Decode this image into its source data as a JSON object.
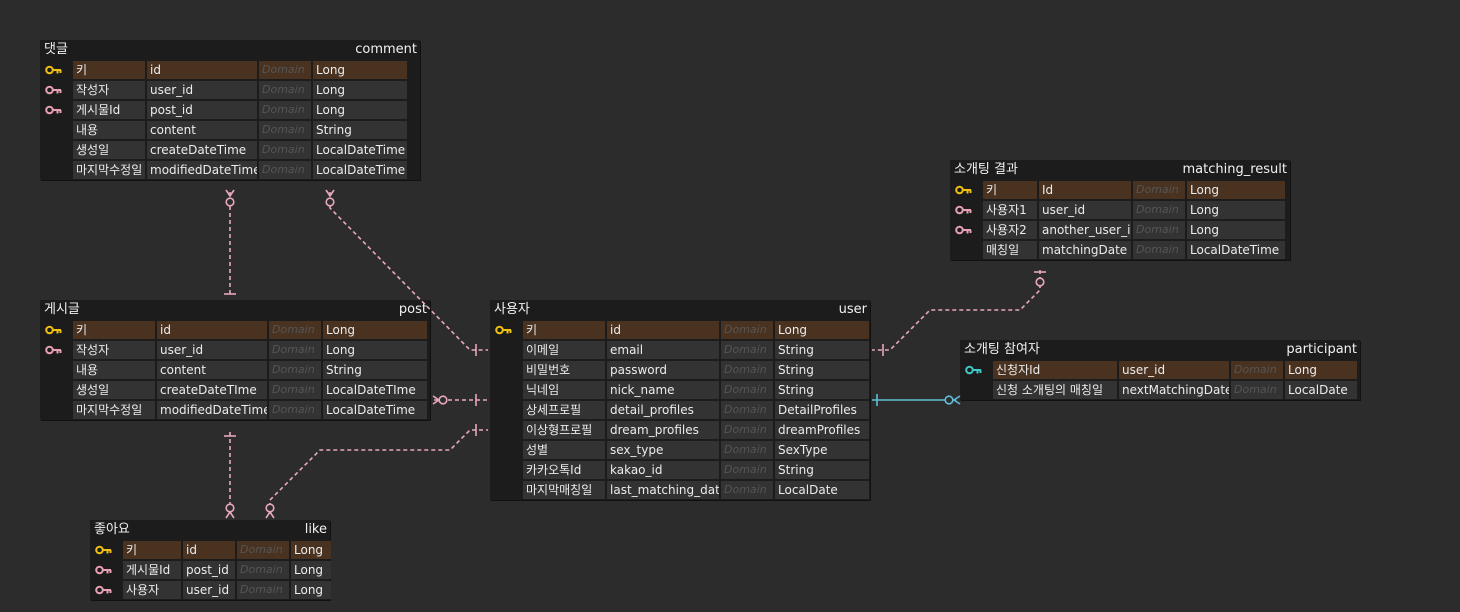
{
  "colors": {
    "background": "#2c2c2c",
    "entity_bg": "#1c1c1c",
    "cell_bg": "#333333",
    "pk_row_bg": "#4a3220",
    "pk_icon": "#f0c010",
    "fk_icon": "#e8a0b4",
    "pfk_icon": "#40c8c8",
    "relation_pink": "#e8a8bc",
    "relation_cyan": "#5fbfd6",
    "domain_text": "#555555"
  },
  "entities": {
    "comment": {
      "logical": "댓글",
      "physical": "comment",
      "rows": [
        {
          "key": "pk",
          "icon": "key-icon",
          "name": "키",
          "col": "id",
          "domain": "Domain",
          "type": "Long"
        },
        {
          "key": "fk",
          "icon": "foreign-key-icon",
          "name": "작성자",
          "col": "user_id",
          "domain": "Domain",
          "type": "Long"
        },
        {
          "key": "fk",
          "icon": "foreign-key-icon",
          "name": "게시물Id",
          "col": "post_id",
          "domain": "Domain",
          "type": "Long"
        },
        {
          "key": "",
          "icon": "",
          "name": "내용",
          "col": "content",
          "domain": "Domain",
          "type": "String"
        },
        {
          "key": "",
          "icon": "",
          "name": "생성일",
          "col": "createDateTime",
          "domain": "Domain",
          "type": "LocalDateTime"
        },
        {
          "key": "",
          "icon": "",
          "name": "마지막수정일",
          "col": "modifiedDateTime",
          "domain": "Domain",
          "type": "LocalDateTime"
        }
      ]
    },
    "post": {
      "logical": "게시글",
      "physical": "post",
      "rows": [
        {
          "key": "pk",
          "icon": "key-icon",
          "name": "키",
          "col": "id",
          "domain": "Domain",
          "type": "Long"
        },
        {
          "key": "fk",
          "icon": "foreign-key-icon",
          "name": "작성자",
          "col": "user_id",
          "domain": "Domain",
          "type": "Long"
        },
        {
          "key": "",
          "icon": "",
          "name": "내용",
          "col": "content",
          "domain": "Domain",
          "type": "String"
        },
        {
          "key": "",
          "icon": "",
          "name": "생성일",
          "col": "createDateTIme",
          "domain": "Domain",
          "type": "LocalDateTIme"
        },
        {
          "key": "",
          "icon": "",
          "name": "마지막수정일",
          "col": "modifiedDateTime",
          "domain": "Domain",
          "type": "LocalDateTime"
        }
      ]
    },
    "like": {
      "logical": "좋아요",
      "physical": "like",
      "rows": [
        {
          "key": "pk",
          "icon": "key-icon",
          "name": "키",
          "col": "id",
          "domain": "Domain",
          "type": "Long"
        },
        {
          "key": "fk",
          "icon": "foreign-key-icon",
          "name": "게시물Id",
          "col": "post_id",
          "domain": "Domain",
          "type": "Long"
        },
        {
          "key": "fk",
          "icon": "foreign-key-icon",
          "name": "사용자",
          "col": "user_id",
          "domain": "Domain",
          "type": "Long"
        }
      ]
    },
    "user": {
      "logical": "사용자",
      "physical": "user",
      "rows": [
        {
          "key": "pk",
          "icon": "key-icon",
          "name": "키",
          "col": "id",
          "domain": "Domain",
          "type": "Long"
        },
        {
          "key": "",
          "icon": "",
          "name": "이메일",
          "col": "email",
          "domain": "Domain",
          "type": "String"
        },
        {
          "key": "",
          "icon": "",
          "name": "비밀번호",
          "col": "password",
          "domain": "Domain",
          "type": "String"
        },
        {
          "key": "",
          "icon": "",
          "name": "닉네임",
          "col": "nick_name",
          "domain": "Domain",
          "type": "String"
        },
        {
          "key": "",
          "icon": "",
          "name": "상세프로필",
          "col": "detail_profiles",
          "domain": "Domain",
          "type": "DetailProfiles"
        },
        {
          "key": "",
          "icon": "",
          "name": "이상형프로필",
          "col": "dream_profiles",
          "domain": "Domain",
          "type": "dreamProfiles"
        },
        {
          "key": "",
          "icon": "",
          "name": "성별",
          "col": "sex_type",
          "domain": "Domain",
          "type": "SexType"
        },
        {
          "key": "",
          "icon": "",
          "name": "카카오톡Id",
          "col": "kakao_id",
          "domain": "Domain",
          "type": "String"
        },
        {
          "key": "",
          "icon": "",
          "name": "마지막매칭일",
          "col": "last_matching_date",
          "domain": "Domain",
          "type": "LocalDate"
        }
      ]
    },
    "matching_result": {
      "logical": "소개팅 결과",
      "physical": "matching_result",
      "rows": [
        {
          "key": "pk",
          "icon": "key-icon",
          "name": "키",
          "col": "Id",
          "domain": "Domain",
          "type": "Long"
        },
        {
          "key": "fk",
          "icon": "foreign-key-icon",
          "name": "사용자1",
          "col": "user_id",
          "domain": "Domain",
          "type": "Long"
        },
        {
          "key": "fk",
          "icon": "foreign-key-icon",
          "name": "사용자2",
          "col": "another_user_id",
          "domain": "Domain",
          "type": "Long"
        },
        {
          "key": "",
          "icon": "",
          "name": "매칭일",
          "col": "matchingDate",
          "domain": "Domain",
          "type": "LocalDateTime"
        }
      ]
    },
    "participant": {
      "logical": "소개팅 참여자",
      "physical": "participant",
      "rows": [
        {
          "key": "pk pfk",
          "icon": "primary-foreign-key-icon",
          "name": "신청자Id",
          "col": "user_id",
          "domain": "Domain",
          "type": "Long"
        },
        {
          "key": "",
          "icon": "",
          "name": "신청 소개팅의 매칭일",
          "col": "nextMatchingDate",
          "domain": "Domain",
          "type": "LocalDate"
        }
      ]
    }
  },
  "relationships": [
    {
      "name": "comment-post",
      "from": "comment",
      "to": "post",
      "style": "non-identifying",
      "color": "pink"
    },
    {
      "name": "comment-user",
      "from": "comment",
      "to": "user",
      "style": "non-identifying",
      "color": "pink"
    },
    {
      "name": "post-user",
      "from": "post",
      "to": "user",
      "style": "non-identifying",
      "color": "pink"
    },
    {
      "name": "like-post",
      "from": "like",
      "to": "post",
      "style": "non-identifying",
      "color": "pink"
    },
    {
      "name": "like-user",
      "from": "like",
      "to": "user",
      "style": "non-identifying",
      "color": "pink"
    },
    {
      "name": "matching-result-user",
      "from": "matching_result",
      "to": "user",
      "style": "non-identifying",
      "color": "pink"
    },
    {
      "name": "participant-user",
      "from": "participant",
      "to": "user",
      "style": "identifying",
      "color": "cyan"
    }
  ]
}
